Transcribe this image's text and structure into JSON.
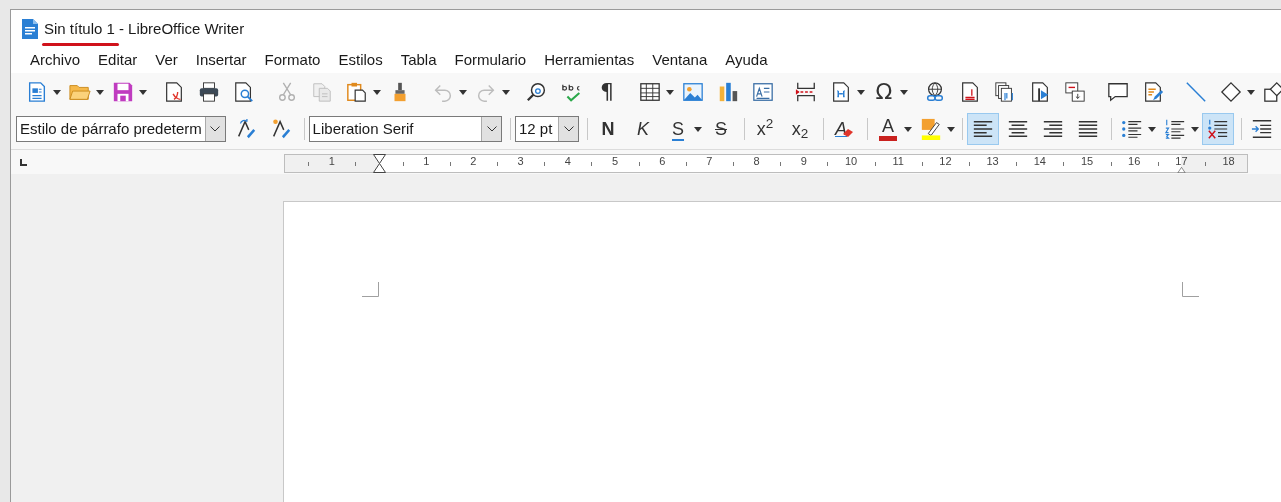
{
  "window": {
    "document_name": "Sin título 1",
    "app_suffix": "- LibreOffice Writer"
  },
  "menu": [
    {
      "label": "Archivo"
    },
    {
      "label": "Editar"
    },
    {
      "label": "Ver"
    },
    {
      "label": "Insertar"
    },
    {
      "label": "Formato"
    },
    {
      "label": "Estilos"
    },
    {
      "label": "Tabla"
    },
    {
      "label": "Formulario"
    },
    {
      "label": "Herramientas"
    },
    {
      "label": "Ventana"
    },
    {
      "label": "Ayuda"
    }
  ],
  "standard_toolbar": [
    [
      {
        "kind": "new",
        "dropdown": true,
        "disabled": false
      },
      {
        "kind": "open",
        "dropdown": true,
        "disabled": false
      },
      {
        "kind": "save",
        "dropdown": true,
        "disabled": false
      }
    ],
    [
      {
        "kind": "pdf",
        "dropdown": false,
        "disabled": false
      },
      {
        "kind": "print",
        "dropdown": false,
        "disabled": false
      },
      {
        "kind": "preview",
        "dropdown": false,
        "disabled": false
      }
    ],
    [
      {
        "kind": "cut",
        "dropdown": false,
        "disabled": true
      },
      {
        "kind": "copy",
        "dropdown": false,
        "disabled": true
      },
      {
        "kind": "paste",
        "dropdown": true,
        "disabled": false
      },
      {
        "kind": "clone",
        "dropdown": false,
        "disabled": false
      }
    ],
    [
      {
        "kind": "undo",
        "dropdown": true,
        "disabled": true
      },
      {
        "kind": "redo",
        "dropdown": true,
        "disabled": true
      }
    ],
    [
      {
        "kind": "find",
        "dropdown": false,
        "disabled": false
      },
      {
        "kind": "spelling",
        "dropdown": false,
        "disabled": false
      },
      {
        "kind": "glyph",
        "label": "¶",
        "dropdown": false,
        "disabled": false
      }
    ],
    [
      {
        "kind": "table",
        "dropdown": true,
        "disabled": false
      },
      {
        "kind": "image",
        "dropdown": false,
        "disabled": false
      },
      {
        "kind": "chart",
        "dropdown": false,
        "disabled": false
      },
      {
        "kind": "textbox",
        "dropdown": false,
        "disabled": false
      }
    ],
    [
      {
        "kind": "pagebreak",
        "dropdown": false,
        "disabled": false
      },
      {
        "kind": "field",
        "dropdown": true,
        "disabled": false
      },
      {
        "kind": "glyph",
        "label": "Ω",
        "dropdown": true,
        "disabled": false
      }
    ],
    [
      {
        "kind": "hyperlink",
        "dropdown": false,
        "disabled": false
      },
      {
        "kind": "footnote",
        "dropdown": false,
        "disabled": false
      },
      {
        "kind": "endnote",
        "dropdown": false,
        "disabled": false
      },
      {
        "kind": "bookmark",
        "dropdown": false,
        "disabled": false
      },
      {
        "kind": "crossref",
        "dropdown": false,
        "disabled": false
      }
    ],
    [
      {
        "kind": "comment",
        "dropdown": false,
        "disabled": false
      },
      {
        "kind": "track",
        "dropdown": false,
        "disabled": false
      }
    ],
    [
      {
        "kind": "line",
        "dropdown": false,
        "disabled": false
      },
      {
        "kind": "shapes",
        "dropdown": true,
        "disabled": false
      },
      {
        "kind": "draw",
        "dropdown": false,
        "disabled": false
      }
    ]
  ],
  "paragraph_style": {
    "value": "Estilo de párrafo predeterm"
  },
  "font_name": {
    "value": "Liberation Serif"
  },
  "font_size": {
    "value": "12 pt"
  },
  "formatting_toolbar": [
    [
      {
        "kind": "update-style",
        "dropdown": false,
        "selected": false
      },
      {
        "kind": "new-style",
        "dropdown": false,
        "selected": false
      }
    ],
    [
      {
        "kind": "bold",
        "label": "N",
        "dropdown": false,
        "selected": false
      },
      {
        "kind": "italic",
        "label": "K",
        "dropdown": false,
        "selected": false
      },
      {
        "kind": "underline",
        "label": "S",
        "dropdown": true,
        "selected": false
      },
      {
        "kind": "strike",
        "label": "S",
        "dropdown": false,
        "selected": false
      }
    ],
    [
      {
        "kind": "script",
        "label": "x$^{2}$",
        "dropdown": false,
        "selected": false
      },
      {
        "kind": "script",
        "label": "x$_{2}$",
        "dropdown": false,
        "selected": false
      }
    ],
    [
      {
        "kind": "clear",
        "label": "A",
        "dropdown": false,
        "selected": false
      }
    ],
    [
      {
        "kind": "fontcolor",
        "label": "A",
        "dropdown": true,
        "selected": false
      },
      {
        "kind": "highlight",
        "dropdown": true,
        "selected": false
      }
    ],
    [
      {
        "kind": "align-left",
        "dropdown": false,
        "selected": true
      },
      {
        "kind": "align-center",
        "dropdown": false,
        "selected": false
      },
      {
        "kind": "align-right",
        "dropdown": false,
        "selected": false
      },
      {
        "kind": "justify",
        "dropdown": false,
        "selected": false
      }
    ],
    [
      {
        "kind": "bullets",
        "dropdown": true,
        "selected": false
      },
      {
        "kind": "numbering",
        "dropdown": true,
        "selected": false
      },
      {
        "kind": "nolist",
        "dropdown": false,
        "selected": true
      }
    ],
    [
      {
        "kind": "indent",
        "dropdown": false,
        "selected": false
      }
    ]
  ],
  "ruler": {
    "left_margin_label": "1",
    "labels": [
      "1",
      "2",
      "3",
      "4",
      "5",
      "6",
      "7",
      "8",
      "9",
      "10",
      "11",
      "12",
      "13",
      "14",
      "15",
      "16",
      "17",
      "18"
    ]
  }
}
